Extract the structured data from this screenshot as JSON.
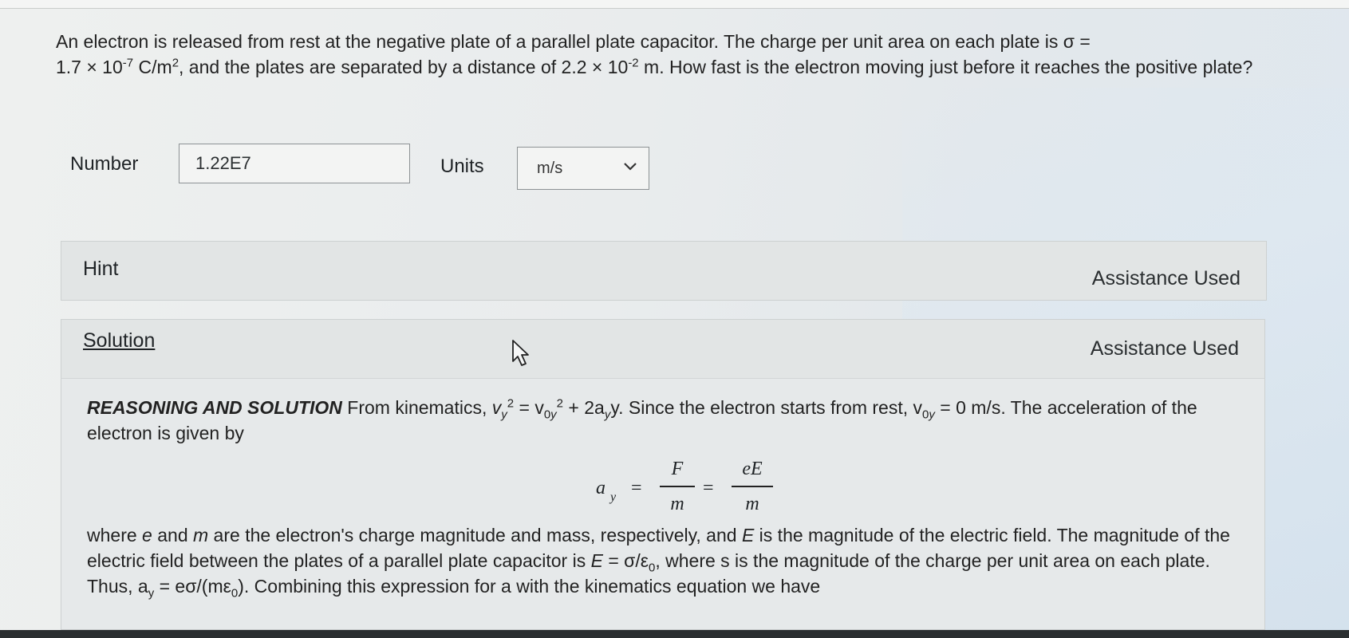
{
  "question": {
    "line1_pre": "An electron is released from rest at the negative plate of a parallel plate capacitor. The charge per unit area on each plate is σ =",
    "sigma_mantissa": "1.7 × 10",
    "sigma_exp": "-7",
    "sigma_unit": " C/m",
    "sigma_unit_exp": "2",
    "line2_mid": ", and the plates are separated by a distance of ",
    "dist_mantissa": "2.2 × 10",
    "dist_exp": "-2",
    "line2_end": " m. How fast is the electron moving just before it reaches the positive plate?"
  },
  "answer": {
    "number_label": "Number",
    "number_value": "1.22E7",
    "units_label": "Units",
    "units_value": "m/s"
  },
  "hint": {
    "title": "Hint",
    "status": "Assistance Used"
  },
  "solution": {
    "title": "Solution",
    "status": "Assistance Used",
    "heading": "REASONING AND SOLUTION",
    "p1_a": " From kinematics, ",
    "p1_b": " + 2a",
    "p1_c": "y. Since the electron starts from rest, v",
    "p1_d": " = 0 m/s. The acceleration of the electron is given by",
    "p2_a": "where ",
    "p2_b": " and ",
    "p2_c": " are the electron's charge magnitude and mass, respectively, and ",
    "p2_d": " is the magnitude of the electric field. The magnitude of the electric field between the plates of a parallel plate capacitor is ",
    "p2_e": " = σ/ε",
    "p2_f": ", where s is the magnitude of the charge per unit area on each plate. Thus, a",
    "p2_g": " = eσ/(mε",
    "p2_h": "). Combining this expression for a with the kinematics equation we have",
    "eq": {
      "lhs": "a",
      "lhs_sub": "y",
      "eq_sign": "=",
      "frac1_num": "F",
      "frac1_den": "m",
      "frac2_num": "eE",
      "frac2_den": "m"
    }
  },
  "icons": [
    "chevron-down-icon",
    "mouse-pointer-icon"
  ]
}
